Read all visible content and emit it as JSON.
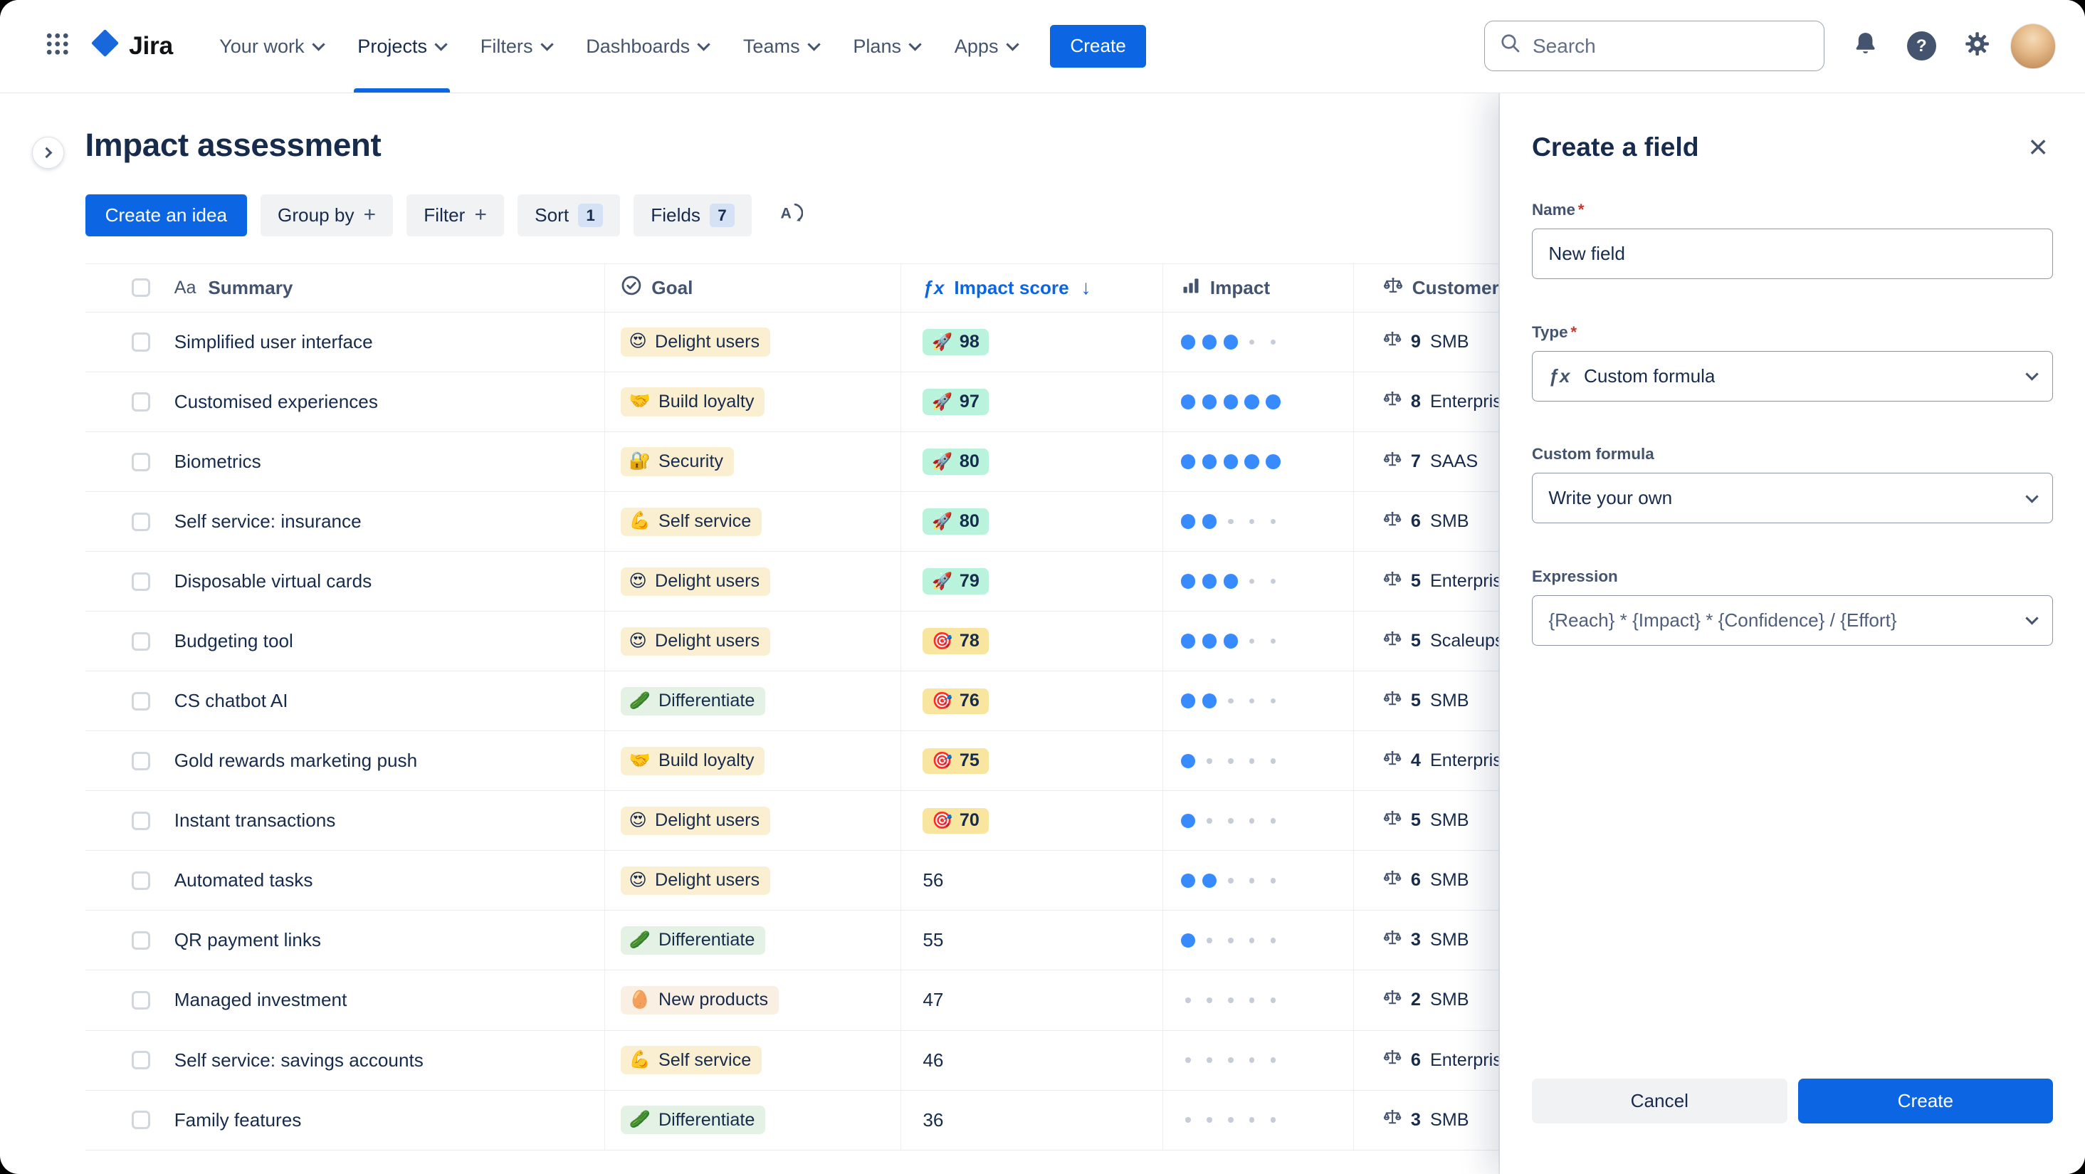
{
  "colors": {
    "accent": "#0C66E4",
    "dot_filled": "#388BFF",
    "score_green": "#BAF3DB",
    "score_yellow": "#F8E6A0"
  },
  "topnav": {
    "logo": "Jira",
    "items": [
      {
        "label": "Your work",
        "active": false
      },
      {
        "label": "Projects",
        "active": true
      },
      {
        "label": "Filters",
        "active": false
      },
      {
        "label": "Dashboards",
        "active": false
      },
      {
        "label": "Teams",
        "active": false
      },
      {
        "label": "Plans",
        "active": false
      },
      {
        "label": "Apps",
        "active": false
      }
    ],
    "create_label": "Create",
    "search_placeholder": "Search",
    "help_glyph": "?"
  },
  "page": {
    "title": "Impact assessment",
    "toolbar": {
      "create_idea_label": "Create an idea",
      "group_by_label": "Group by",
      "filter_label": "Filter",
      "sort_label": "Sort",
      "sort_count": "1",
      "fields_label": "Fields",
      "fields_count": "7",
      "plus_glyph": "+"
    }
  },
  "table": {
    "impact_max": 5,
    "columns": [
      {
        "label": "Summary",
        "icon": "text-style-icon",
        "icon_glyph": "Aa"
      },
      {
        "label": "Goal",
        "icon": "goal-status-icon"
      },
      {
        "label": "Impact score",
        "icon": "formula-icon",
        "icon_glyph": "ƒx",
        "sorted": "desc",
        "sort_glyph": "↓"
      },
      {
        "label": "Impact",
        "icon": "bar-chart-icon"
      },
      {
        "label": "Customer",
        "icon": "scale-icon"
      }
    ],
    "rows": [
      {
        "summary": "Simplified user interface",
        "goal": "Delight users",
        "goal_icon": "😍",
        "goal_bg": "#FBEFD2",
        "score": "98",
        "score_icon": "🚀",
        "score_bg": "#BAF3DB",
        "impact": 3,
        "customer_count": "9",
        "customer_label": "SMB"
      },
      {
        "summary": "Customised experiences",
        "goal": "Build loyalty",
        "goal_icon": "🤝",
        "goal_bg": "#FBEFD2",
        "score": "97",
        "score_icon": "🚀",
        "score_bg": "#BAF3DB",
        "impact": 5,
        "customer_count": "8",
        "customer_label": "Enterprise"
      },
      {
        "summary": "Biometrics",
        "goal": "Security",
        "goal_icon": "🔐",
        "goal_bg": "#FBEFD2",
        "score": "80",
        "score_icon": "🚀",
        "score_bg": "#BAF3DB",
        "impact": 5,
        "customer_count": "7",
        "customer_label": "SAAS"
      },
      {
        "summary": "Self service: insurance",
        "goal": "Self service",
        "goal_icon": "💪",
        "goal_bg": "#FBEFD2",
        "score": "80",
        "score_icon": "🚀",
        "score_bg": "#BAF3DB",
        "impact": 2,
        "customer_count": "6",
        "customer_label": "SMB"
      },
      {
        "summary": "Disposable virtual cards",
        "goal": "Delight users",
        "goal_icon": "😍",
        "goal_bg": "#FBEFD2",
        "score": "79",
        "score_icon": "🚀",
        "score_bg": "#BAF3DB",
        "impact": 3,
        "customer_count": "5",
        "customer_label": "Enterprise"
      },
      {
        "summary": "Budgeting tool",
        "goal": "Delight users",
        "goal_icon": "😍",
        "goal_bg": "#FBEFD2",
        "score": "78",
        "score_icon": "🎯",
        "score_bg": "#F8E6A0",
        "impact": 3,
        "customer_count": "5",
        "customer_label": "Scaleups"
      },
      {
        "summary": "CS chatbot AI",
        "goal": "Differentiate",
        "goal_icon": "🥒",
        "goal_bg": "#E3F2E4",
        "score": "76",
        "score_icon": "🎯",
        "score_bg": "#F8E6A0",
        "impact": 2,
        "customer_count": "5",
        "customer_label": "SMB"
      },
      {
        "summary": "Gold rewards marketing push",
        "goal": "Build loyalty",
        "goal_icon": "🤝",
        "goal_bg": "#FBEFD2",
        "score": "75",
        "score_icon": "🎯",
        "score_bg": "#F8E6A0",
        "impact": 1,
        "customer_count": "4",
        "customer_label": "Enterprise"
      },
      {
        "summary": "Instant transactions",
        "goal": "Delight users",
        "goal_icon": "😍",
        "goal_bg": "#FBEFD2",
        "score": "70",
        "score_icon": "🎯",
        "score_bg": "#F8E6A0",
        "impact": 1,
        "customer_count": "5",
        "customer_label": "SMB"
      },
      {
        "summary": "Automated tasks",
        "goal": "Delight users",
        "goal_icon": "😍",
        "goal_bg": "#FBEFD2",
        "score": "56",
        "score_icon": "",
        "score_bg": "",
        "impact": 2,
        "customer_count": "6",
        "customer_label": "SMB"
      },
      {
        "summary": "QR payment links",
        "goal": "Differentiate",
        "goal_icon": "🥒",
        "goal_bg": "#E3F2E4",
        "score": "55",
        "score_icon": "",
        "score_bg": "",
        "impact": 1,
        "customer_count": "3",
        "customer_label": "SMB"
      },
      {
        "summary": "Managed investment",
        "goal": "New products",
        "goal_icon": "🥚",
        "goal_bg": "#F9EFE3",
        "score": "47",
        "score_icon": "",
        "score_bg": "",
        "impact": 0,
        "customer_count": "2",
        "customer_label": "SMB"
      },
      {
        "summary": "Self service: savings accounts",
        "goal": "Self service",
        "goal_icon": "💪",
        "goal_bg": "#FBEFD2",
        "score": "46",
        "score_icon": "",
        "score_bg": "",
        "impact": 0,
        "customer_count": "6",
        "customer_label": "Enterprise"
      },
      {
        "summary": "Family features",
        "goal": "Differentiate",
        "goal_icon": "🥒",
        "goal_bg": "#E3F2E4",
        "score": "36",
        "score_icon": "",
        "score_bg": "",
        "impact": 0,
        "customer_count": "3",
        "customer_label": "SMB"
      }
    ]
  },
  "panel": {
    "title": "Create a field",
    "name_label": "Name",
    "name_value": "New field",
    "type_label": "Type",
    "type_icon_glyph": "ƒx",
    "type_value": "Custom formula",
    "formula_label": "Custom formula",
    "formula_value": "Write your own",
    "expression_label": "Expression",
    "expression_value": "{Reach} * {Impact} * {Confidence} / {Effort}",
    "cancel_label": "Cancel",
    "create_label": "Create",
    "required_glyph": "*",
    "close_glyph": "×"
  }
}
